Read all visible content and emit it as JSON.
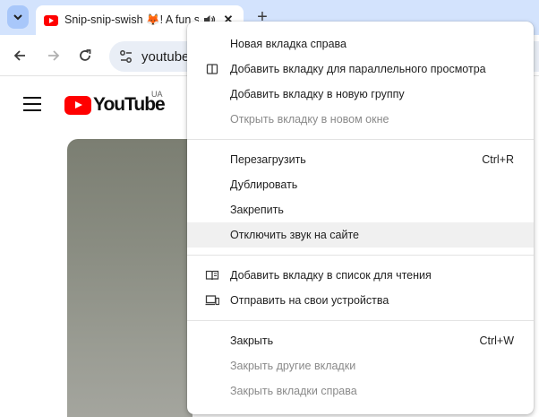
{
  "tab": {
    "title": "Snip-snip-swish 🦊! A fun s"
  },
  "toolbar": {
    "url": "youtube"
  },
  "page": {
    "logo_text": "YouTube",
    "country_code": "UA"
  },
  "menu": {
    "group1": [
      {
        "label": "Новая вкладка справа"
      },
      {
        "label": "Добавить вкладку для параллельного просмотра"
      },
      {
        "label": "Добавить вкладку в новую группу"
      },
      {
        "label": "Открыть вкладку в новом окне"
      }
    ],
    "group2": [
      {
        "label": "Перезагрузить",
        "shortcut": "Ctrl+R"
      },
      {
        "label": "Дублировать"
      },
      {
        "label": "Закрепить"
      },
      {
        "label": "Отключить звук на сайте"
      }
    ],
    "group3": [
      {
        "label": "Добавить вкладку в список для чтения"
      },
      {
        "label": "Отправить на свои устройства"
      }
    ],
    "group4": [
      {
        "label": "Закрыть",
        "shortcut": "Ctrl+W"
      },
      {
        "label": "Закрыть другие вкладки"
      },
      {
        "label": "Закрыть вкладки справа"
      }
    ]
  }
}
